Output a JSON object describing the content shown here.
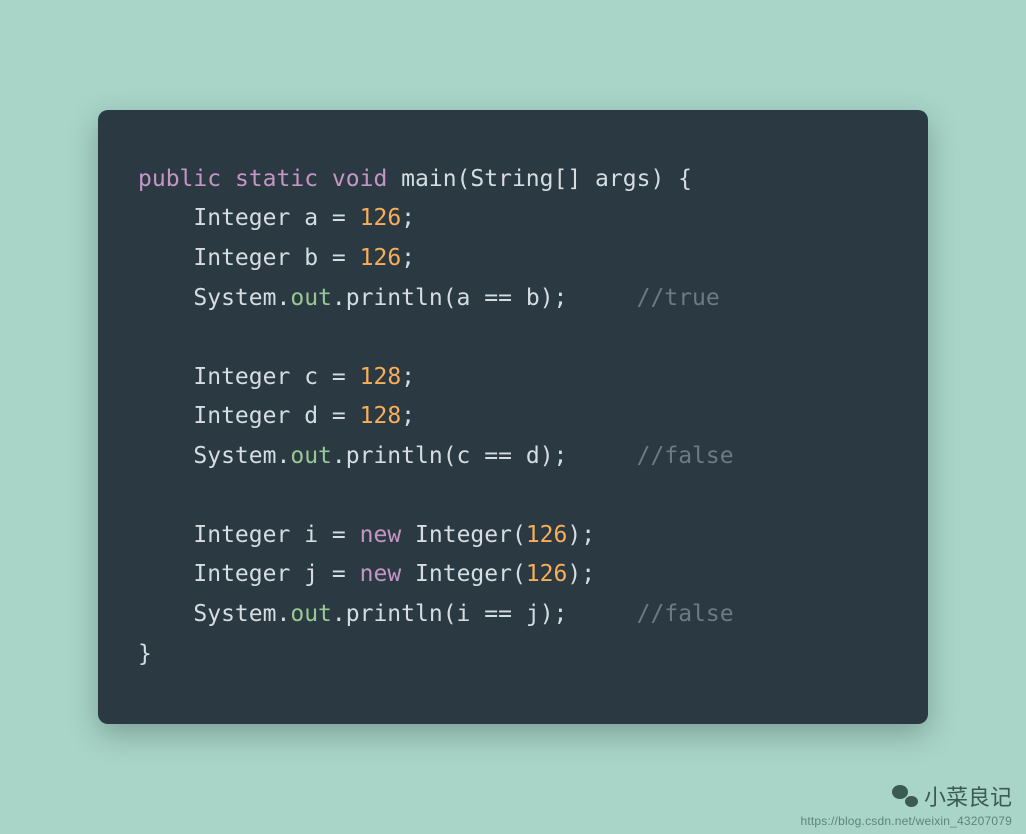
{
  "code": {
    "kw_public": "public",
    "kw_static": "static",
    "kw_void": "void",
    "kw_new_1": "new",
    "kw_new_2": "new",
    "fn_main": "main",
    "type_stringarr": "String[]",
    "id_args": "args",
    "type_integer": "Integer",
    "id_a": "a",
    "id_b": "b",
    "id_c": "c",
    "id_d": "d",
    "id_i": "i",
    "id_j": "j",
    "num_126_a": "126",
    "num_126_b": "126",
    "num_128_c": "128",
    "num_128_d": "128",
    "num_126_i": "126",
    "num_126_j": "126",
    "sys": "System",
    "out": "out",
    "println": "println",
    "eqeq": "==",
    "cmt_true": "//true",
    "cmt_false1": "//false",
    "cmt_false2": "//false",
    "p_open": "(",
    "p_close": ")",
    "brace_open": "{",
    "brace_close": "}",
    "semi": ";",
    "dot": ".",
    "assign": "="
  },
  "footer": {
    "title": "小菜良记",
    "url": "https://blog.csdn.net/weixin_43207079"
  }
}
